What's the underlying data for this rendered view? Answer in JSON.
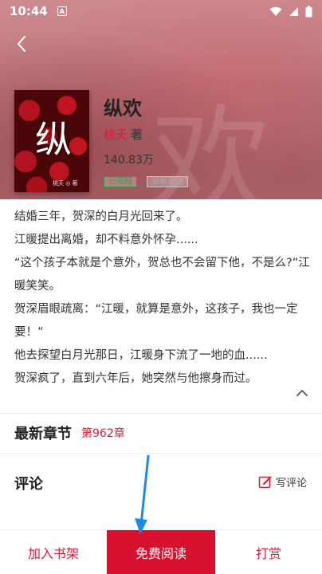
{
  "status_bar": {
    "time": "10:44",
    "notification_glyph": "A",
    "icons": [
      "wifi-icon",
      "signal-icon",
      "battery-icon"
    ]
  },
  "header": {
    "back_icon": "chevron-left-icon"
  },
  "book": {
    "cover_title": "纵",
    "cover_author": "桃夭 ◎ 著",
    "title": "纵欢",
    "author": "桃夭",
    "author_role": "著",
    "word_count": "140.83万",
    "tags": [
      "已完结",
      "总裁豪门"
    ]
  },
  "synopsis": {
    "lines": [
      "结婚三年，贺深的白月光回来了。",
      "江暖提出离婚，却不料意外怀孕......",
      "“这个孩子本就是个意外，贺总也不会留下他，不是么?”江暖笑笑。",
      "贺深眉眼疏离：“江暖，就算是意外，这孩子，我也一定要！”",
      "他去探望白月光那日，江暖身下流了一地的血......",
      "贺深疯了，直到六年后，她突然与他擦身而过。"
    ],
    "collapse_icon": "chevron-up-icon"
  },
  "latest": {
    "title": "最新章节",
    "chapter": "第962章"
  },
  "comments": {
    "title": "评论",
    "write_label": "写评论",
    "write_icon": "edit-icon"
  },
  "bottom_bar": {
    "add_shelf": "加入书架",
    "free_read": "免费阅读",
    "tip": "打赏"
  },
  "colors": {
    "accent": "#d31f3c",
    "read_button": "#d8122e",
    "complete_tag": "#2f9e3f",
    "arrow": "#1e88e5"
  }
}
